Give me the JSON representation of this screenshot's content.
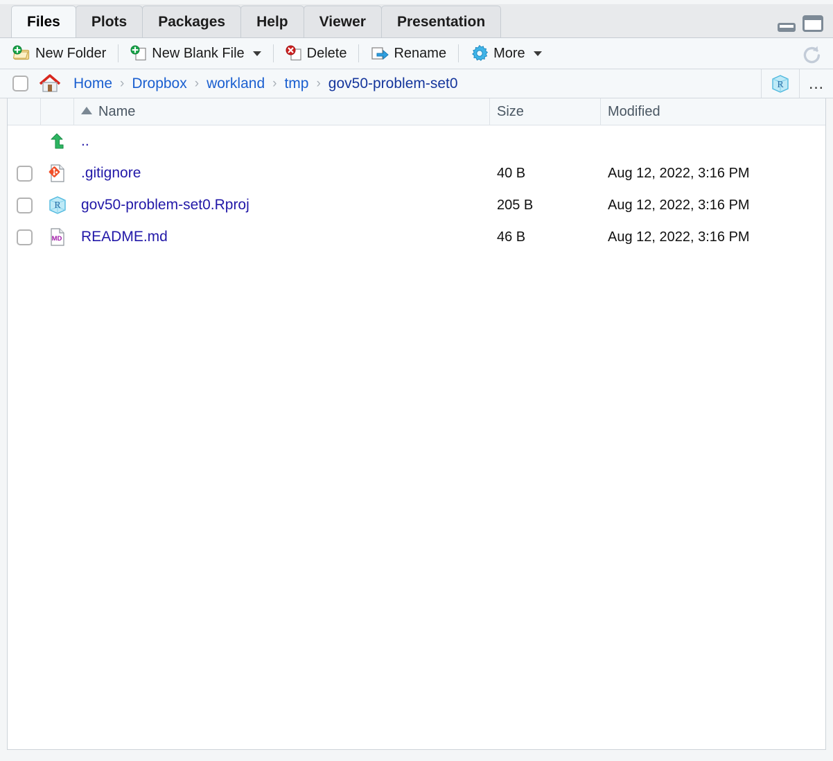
{
  "window": {
    "minimize_label": "Minimize",
    "maximize_label": "Maximize"
  },
  "tabs": [
    {
      "label": "Files",
      "active": true
    },
    {
      "label": "Plots",
      "active": false
    },
    {
      "label": "Packages",
      "active": false
    },
    {
      "label": "Help",
      "active": false
    },
    {
      "label": "Viewer",
      "active": false
    },
    {
      "label": "Presentation",
      "active": false
    }
  ],
  "toolbar": {
    "new_folder_label": "New Folder",
    "new_blank_file_label": "New Blank File",
    "delete_label": "Delete",
    "rename_label": "Rename",
    "more_label": "More",
    "refresh_icon": "refresh-icon",
    "new_folder_icon": "new-folder-icon",
    "new_blank_file_icon": "new-file-icon",
    "delete_icon": "delete-icon",
    "rename_icon": "rename-icon",
    "more_icon": "gear-icon"
  },
  "path": {
    "select_all_checkbox": "",
    "home_icon": "home-icon",
    "crumbs": [
      {
        "label": "Home",
        "current": false
      },
      {
        "label": "Dropbox",
        "current": false
      },
      {
        "label": "workland",
        "current": false
      },
      {
        "label": "tmp",
        "current": false
      },
      {
        "label": "gov50-problem-set0",
        "current": true
      }
    ],
    "separator": "›",
    "rproject_icon": "r-project-icon",
    "more_actions_label": "…"
  },
  "table": {
    "columns": {
      "name": "Name",
      "size": "Size",
      "modified": "Modified"
    },
    "sort": {
      "column": "Name",
      "direction": "ascending",
      "icon": "sort-ascending-icon"
    },
    "rows": [
      {
        "name": "..",
        "size": "",
        "modified": "",
        "icon": "up-arrow-icon",
        "has_checkbox": false
      },
      {
        "name": ".gitignore",
        "size": "40 B",
        "modified": "Aug 12, 2022, 3:16 PM",
        "icon": "git-file-icon",
        "has_checkbox": true
      },
      {
        "name": "gov50-problem-set0.Rproj",
        "size": "205 B",
        "modified": "Aug 12, 2022, 3:16 PM",
        "icon": "r-project-icon",
        "has_checkbox": true
      },
      {
        "name": "README.md",
        "size": "46 B",
        "modified": "Aug 12, 2022, 3:16 PM",
        "icon": "markdown-file-icon",
        "has_checkbox": true
      }
    ]
  },
  "colors": {
    "link": "#1a5fd0",
    "link_current": "#15369c",
    "file_link": "#2218a8",
    "accent_green": "#23a455",
    "accent_red": "#e8432a",
    "accent_blue": "#35a8de",
    "panel_bg": "#f5f8fa",
    "tabbar_bg": "#e8eaec"
  }
}
